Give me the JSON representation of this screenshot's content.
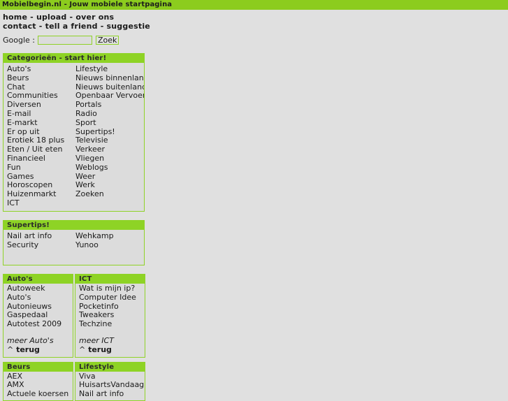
{
  "titlebar": {
    "text": "Mobielbegin.nl - Jouw mobiele startpagina"
  },
  "nav": {
    "row1": [
      {
        "label": "home"
      },
      {
        "label": "upload"
      },
      {
        "label": "over ons"
      }
    ],
    "row2": [
      {
        "label": "contact"
      },
      {
        "label": "tell a friend"
      },
      {
        "label": "suggestie"
      }
    ],
    "separator": " - "
  },
  "search": {
    "label": "Google :",
    "value": "",
    "placeholder": "",
    "button_label": "Zoek"
  },
  "panels": {
    "categorieen": {
      "title": "Categorieën - start hier!",
      "col_left": [
        "Auto's",
        "Beurs",
        "Chat",
        "Communities",
        "Diversen",
        "E-mail",
        "E-markt",
        "Er op uit",
        "Erotiek 18 plus",
        "Eten / Uit eten",
        "Financieel",
        "Fun",
        "Games",
        "Horoscopen",
        "Huizenmarkt",
        "ICT"
      ],
      "col_right": [
        "Lifestyle",
        "Nieuws binnenland",
        "Nieuws buitenland",
        "Openbaar Vervoer",
        "Portals",
        "Radio",
        "Sport",
        "Supertips!",
        "Televisie",
        "Verkeer",
        "Vliegen",
        "Weblogs",
        "Weer",
        "Werk",
        "Zoeken"
      ]
    },
    "supertips": {
      "title": "Supertips!",
      "col_left": [
        "Nail art info",
        "Security"
      ],
      "col_right": [
        "Wehkamp",
        "Yunoo"
      ]
    },
    "autos": {
      "title": "Auto's",
      "links": [
        "Autoweek",
        "Auto's",
        "Autonieuws",
        "Gaspedaal",
        "Autotest 2009"
      ],
      "meer_label": "meer Auto's",
      "terug_caret": "^",
      "terug_label": "terug"
    },
    "ict": {
      "title": "ICT",
      "links": [
        "Wat is mijn ip?",
        "Computer Idee",
        "Pocketinfo",
        "Tweakers",
        "Techzine"
      ],
      "meer_label": "meer ICT",
      "terug_caret": "^",
      "terug_label": "terug"
    },
    "beurs": {
      "title": "Beurs",
      "links": [
        "AEX",
        "AMX",
        "Actuele koersen"
      ]
    },
    "lifestyle": {
      "title": "Lifestyle",
      "links": [
        "Viva",
        "HuisartsVandaag",
        "Nail art info"
      ]
    }
  },
  "colors": {
    "brand_green": "#8ed325",
    "titlebar_green": "#8ccc1e",
    "panel_bg": "#dcdcdc",
    "page_bg": "#e0e0e0",
    "text": "#1a1a1a"
  }
}
